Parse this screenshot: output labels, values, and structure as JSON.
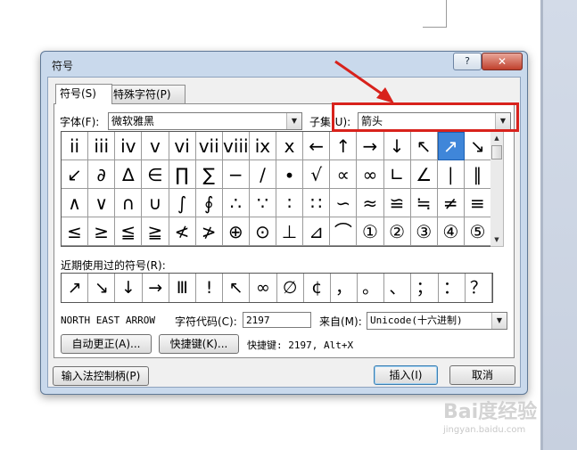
{
  "window": {
    "title": "符号",
    "help_glyph": "?",
    "close_glyph": "✕"
  },
  "tabs": [
    {
      "label": "符号(S)",
      "active": true
    },
    {
      "label": "特殊字符(P)",
      "active": false
    }
  ],
  "font": {
    "label": "字体(F):",
    "value": "微软雅黑"
  },
  "subset": {
    "label": "子集(U):",
    "value": "箭头"
  },
  "grid_rows": [
    [
      "ii",
      "iii",
      "iv",
      "v",
      "vi",
      "vii",
      "viii",
      "ix",
      "x",
      "←",
      "↑",
      "→",
      "↓",
      "↖",
      "↗",
      "↘"
    ],
    [
      "↙",
      "∂",
      "∆",
      "∈",
      "∏",
      "∑",
      "−",
      "∕",
      "∙",
      "√",
      "∝",
      "∞",
      "∟",
      "∠",
      "∣",
      "∥"
    ],
    [
      "∧",
      "∨",
      "∩",
      "∪",
      "∫",
      "∮",
      "∴",
      "∵",
      "∶",
      "∷",
      "∽",
      "≈",
      "≌",
      "≒",
      "≠",
      "≡"
    ],
    [
      "≤",
      "≥",
      "≦",
      "≧",
      "≮",
      "≯",
      "⊕",
      "⊙",
      "⊥",
      "⊿",
      "⌒",
      "①",
      "②",
      "③",
      "④",
      "⑤"
    ]
  ],
  "selected_symbol": "↗",
  "recent": {
    "label": "近期使用过的符号(R):",
    "symbols": [
      "↗",
      "↘",
      "↓",
      "→",
      "Ⅲ",
      "!",
      "↖",
      "∞",
      "∅",
      "¢",
      "，",
      "。",
      "、",
      "；",
      "：",
      "？"
    ]
  },
  "char_name": "NORTH EAST ARROW",
  "char_code": {
    "label": "字符代码(C):",
    "value": "2197"
  },
  "from": {
    "label": "来自(M):",
    "value": "Unicode(十六进制)"
  },
  "buttons": {
    "autocorrect": "自动更正(A)...",
    "shortcut_key": "快捷键(K)...",
    "ime_handle": "输入法控制柄(P)",
    "insert": "插入(I)",
    "cancel": "取消"
  },
  "shortcut_text": "快捷键: 2197, Alt+X",
  "watermark": {
    "main": "Bai度经验",
    "sub": "jingyan.baidu.com"
  },
  "colors": {
    "annotation": "#d8221c",
    "selection": "#3f86d9"
  }
}
